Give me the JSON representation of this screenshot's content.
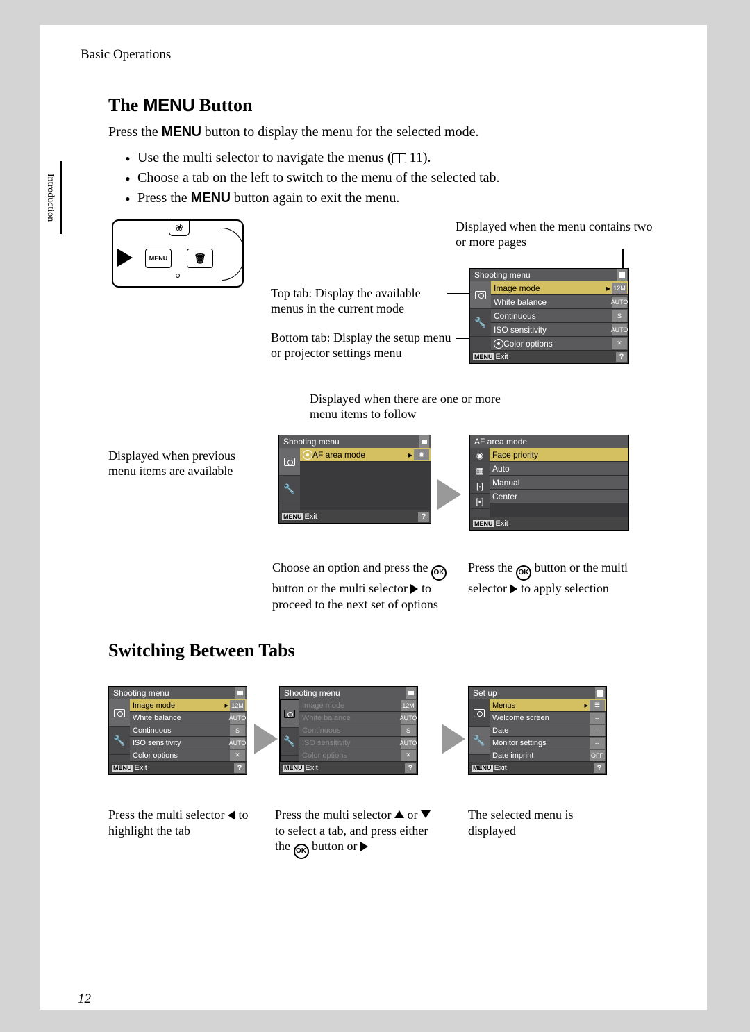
{
  "breadcrumb": "Basic Operations",
  "side_tab": "Introduction",
  "heading1_prefix": "The ",
  "heading1_menu": "MENU",
  "heading1_suffix": " Button",
  "intro_a": "Press the ",
  "intro_b": " button to display the menu for the selected mode.",
  "bullets": {
    "b1a": "Use the multi selector to navigate the menus (",
    "b1b": " 11).",
    "b2": "Choose a tab on the left to switch to the menu of the selected tab.",
    "b3a": "Press the ",
    "b3b": " button again to exit the menu."
  },
  "cam_btn_menu": "MENU",
  "notes": {
    "n1": "Top tab: Display the available menus in the current mode",
    "n2": "Bottom tab: Display the setup menu or projector settings menu",
    "n3": "Displayed when the menu contains two or more pages",
    "n4": "Displayed when there are one or more menu items to follow",
    "n5": "Displayed when previous menu items are available",
    "n6a": "Choose an option and press the ",
    "n6b": " button or the multi selector ",
    "n6c": " to proceed to the next set of options",
    "n7a": "Press the ",
    "n7b": " button or the multi selector ",
    "n7c": " to apply selection",
    "n8a": "Press the multi selector ",
    "n8b": " to highlight the tab",
    "n9a": "Press the multi selector ",
    "n9b": " or ",
    "n9c": " to select a tab, and press either the ",
    "n9d": " button or ",
    "n10": "The selected menu is displayed"
  },
  "menu1": {
    "title": "Shooting menu",
    "r1": "Image mode",
    "v1": "12M",
    "r2": "White balance",
    "v2": "AUTO",
    "r3": "Continuous",
    "v3": "S",
    "r4": "ISO sensitivity",
    "v4": "AUTO",
    "r5": "Color options",
    "v5": "✕",
    "exit": "Exit"
  },
  "menu2": {
    "title": "Shooting menu",
    "r1": "AF area mode",
    "exit": "Exit"
  },
  "menu3": {
    "title": "AF area mode",
    "r1": "Face priority",
    "r2": "Auto",
    "r3": "Manual",
    "r4": "Center",
    "exit": "Exit"
  },
  "heading2": "Switching Between Tabs",
  "menu5": {
    "title": "Shooting menu",
    "exit": "Exit"
  },
  "menu6": {
    "title": "Set up",
    "r1": "Menus",
    "v1": "☰",
    "r2": "Welcome screen",
    "v2": "--",
    "r3": "Date",
    "v3": "--",
    "r4": "Monitor settings",
    "v4": "--",
    "r5": "Date imprint",
    "v5": "OFF",
    "exit": "Exit"
  },
  "menu_word": "MENU",
  "ok": "OK",
  "page_num": "12",
  "help": "?"
}
